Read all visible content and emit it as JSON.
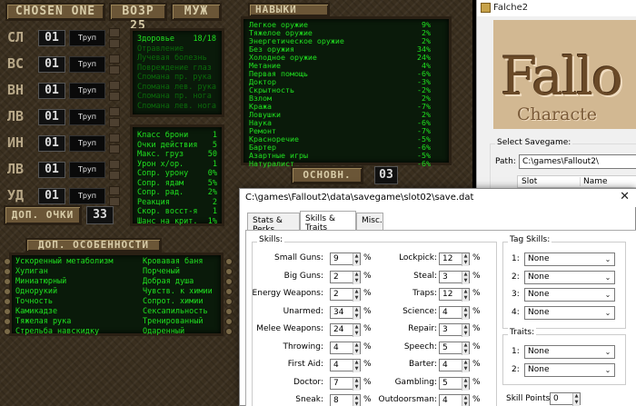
{
  "game": {
    "name": "CHOSEN ONE",
    "age": "ВОЗР 25",
    "sex": "МУЖ",
    "stats": [
      {
        "label": "СЛ",
        "value": "01",
        "word": "Труп"
      },
      {
        "label": "ВС",
        "value": "01",
        "word": "Труп"
      },
      {
        "label": "ВН",
        "value": "01",
        "word": "Труп"
      },
      {
        "label": "ЛВ",
        "value": "01",
        "word": "Труп"
      },
      {
        "label": "ИН",
        "value": "01",
        "word": "Труп"
      },
      {
        "label": "ЛВ",
        "value": "01",
        "word": "Труп"
      },
      {
        "label": "УД",
        "value": "01",
        "word": "Труп"
      }
    ],
    "extra_points_label": "ДОП. ОЧКИ",
    "extra_points": "33",
    "health": {
      "label": "Здоровье",
      "value": "18/18"
    },
    "conditions": [
      "Отравление",
      "Лучевая болезнь",
      "Повреждение глаз",
      "Сломана пр. рука",
      "Сломана лев. рука",
      "Сломана пр. нога",
      "Сломана лев. нога"
    ],
    "derived": [
      {
        "name": "Класс брони",
        "value": "1"
      },
      {
        "name": "Очки действия",
        "value": "5"
      },
      {
        "name": "Макс. груз",
        "value": "50"
      },
      {
        "name": "Урон х/ор.",
        "value": "1"
      },
      {
        "name": "Сопр. урону",
        "value": "0%"
      },
      {
        "name": "Сопр. ядам",
        "value": "5%"
      },
      {
        "name": "Сопр. рад.",
        "value": "2%"
      },
      {
        "name": "Реакция",
        "value": "2"
      },
      {
        "name": "Скор. восст-я",
        "value": "1"
      },
      {
        "name": "Шанс на крит.",
        "value": "1%"
      }
    ],
    "skills_title": "НАВЫКИ",
    "skills": [
      {
        "name": "Легкое оружие",
        "value": "9%"
      },
      {
        "name": "Тяжелое оружие",
        "value": "2%"
      },
      {
        "name": "Энергетическое оружие",
        "value": "2%"
      },
      {
        "name": "Без оружия",
        "value": "34%"
      },
      {
        "name": "Холодное оружие",
        "value": "24%"
      },
      {
        "name": "Метание",
        "value": "4%"
      },
      {
        "name": "Первая помощь",
        "value": "-6%"
      },
      {
        "name": "Доктор",
        "value": "-3%"
      },
      {
        "name": "Скрытность",
        "value": "-2%"
      },
      {
        "name": "Взлом",
        "value": "2%"
      },
      {
        "name": "Кража",
        "value": "-7%"
      },
      {
        "name": "Ловушки",
        "value": "2%"
      },
      {
        "name": "Наука",
        "value": "-6%"
      },
      {
        "name": "Ремонт",
        "value": "-7%"
      },
      {
        "name": "Красноречие",
        "value": "-5%"
      },
      {
        "name": "Бартер",
        "value": "-6%"
      },
      {
        "name": "Азартные игры",
        "value": "-5%"
      },
      {
        "name": "Натуралист",
        "value": "-6%"
      }
    ],
    "skill_points_label": "ОСНОВН.",
    "skill_points": "03",
    "traits_title": "ДОП. ОСОБЕННОСТИ",
    "traits_left": [
      "Ускоренный метаболизм",
      "Хулиган",
      "Миниатюрный",
      "Однорукий",
      "Точность",
      "Камикадзе",
      "Тяжелая рука",
      "Стрельба навскидку"
    ],
    "traits_right": [
      "Кровавая баня",
      "Порченый",
      "Добрая душа",
      "Чувств. к химии",
      "Сопрот. химии",
      "Сексапильность",
      "Тренированный",
      "Одаренный"
    ]
  },
  "falche": {
    "title": "Falche2",
    "banner_big": "Fallo",
    "banner_sub": "Characte",
    "select_label": "Select Savegame:",
    "path_label": "Path:",
    "path_value": "C:\\games\\Fallout2\\",
    "col_slot": "Slot",
    "col_name": "Name"
  },
  "dialog": {
    "title": "C:\\games\\Fallout2\\data\\savegame\\slot02\\save.dat",
    "tabs": [
      "Stats & Perks",
      "Skills & Traits",
      "Misc."
    ],
    "active_tab": "Skills & Traits",
    "skills_group": "Skills:",
    "skills_left": [
      {
        "name": "Small Guns:",
        "value": "9"
      },
      {
        "name": "Big Guns:",
        "value": "2"
      },
      {
        "name": "Energy Weapons:",
        "value": "2"
      },
      {
        "name": "Unarmed:",
        "value": "34"
      },
      {
        "name": "Melee Weapons:",
        "value": "24"
      },
      {
        "name": "Throwing:",
        "value": "4"
      },
      {
        "name": "First Aid:",
        "value": "4"
      },
      {
        "name": "Doctor:",
        "value": "7"
      },
      {
        "name": "Sneak:",
        "value": "8"
      }
    ],
    "skills_right": [
      {
        "name": "Lockpick:",
        "value": "12"
      },
      {
        "name": "Steal:",
        "value": "3"
      },
      {
        "name": "Traps:",
        "value": "12"
      },
      {
        "name": "Science:",
        "value": "4"
      },
      {
        "name": "Repair:",
        "value": "3"
      },
      {
        "name": "Speech:",
        "value": "5"
      },
      {
        "name": "Barter:",
        "value": "4"
      },
      {
        "name": "Gambling:",
        "value": "5"
      },
      {
        "name": "Outdoorsman:",
        "value": "4"
      }
    ],
    "percent": "%",
    "tag_group": "Tag Skills:",
    "tag_skills": [
      {
        "n": "1:",
        "v": "None"
      },
      {
        "n": "2:",
        "v": "None"
      },
      {
        "n": "3:",
        "v": "None"
      },
      {
        "n": "4:",
        "v": "None"
      }
    ],
    "traits_group": "Traits:",
    "traits": [
      {
        "n": "1:",
        "v": "None"
      },
      {
        "n": "2:",
        "v": "None"
      }
    ],
    "skill_points_label": "Skill Points:",
    "skill_points": "0"
  }
}
